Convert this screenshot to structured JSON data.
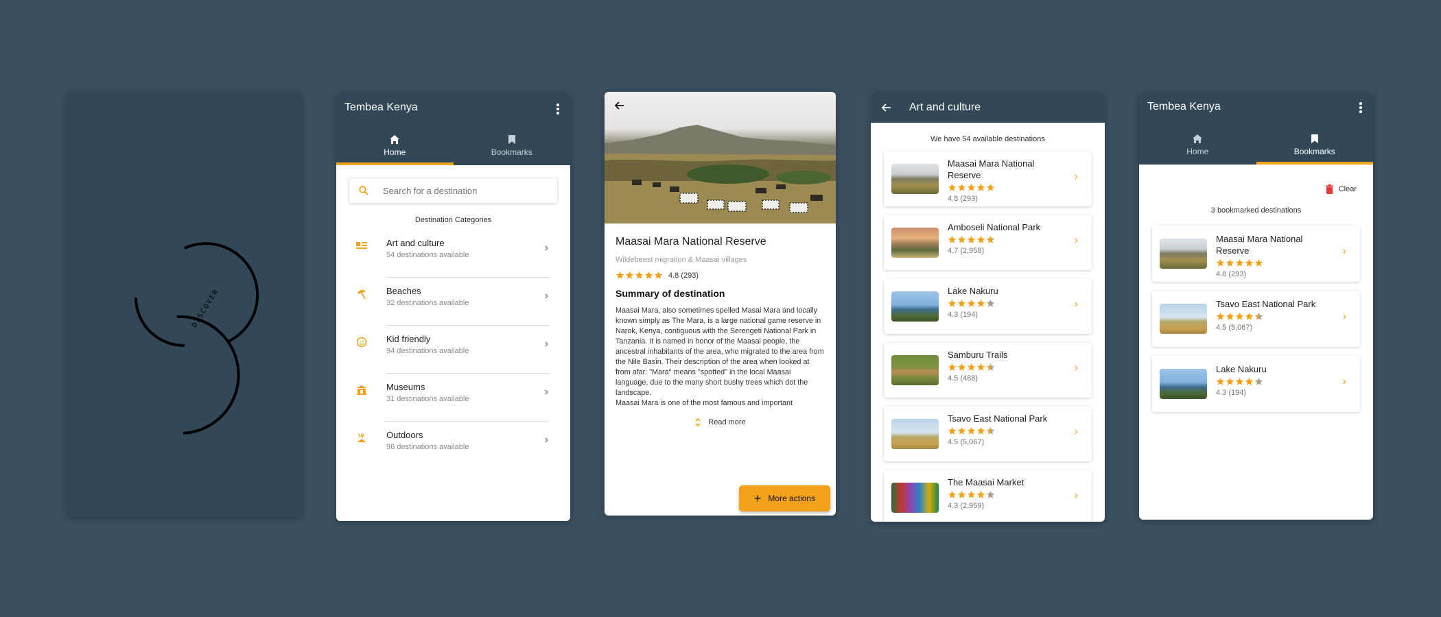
{
  "splash": {
    "label": "DISCOVER"
  },
  "home": {
    "title": "Tembea Kenya",
    "tabs": [
      {
        "label": "Home",
        "icon": "home-icon"
      },
      {
        "label": "Bookmarks",
        "icon": "bookmark-icon"
      }
    ],
    "search": {
      "placeholder": "Search for a destination"
    },
    "section_title": "Destination Categories",
    "categories": [
      {
        "name": "Art and culture",
        "sub": "54 destinations available",
        "icon": "art-culture-icon"
      },
      {
        "name": "Beaches",
        "sub": "32 destinations available",
        "icon": "beach-umbrella-icon"
      },
      {
        "name": "Kid friendly",
        "sub": "94 destinations available",
        "icon": "kid-face-icon"
      },
      {
        "name": "Museums",
        "sub": "31 destinations available",
        "icon": "museum-icon"
      },
      {
        "name": "Outdoors",
        "sub": "96 destinations available",
        "icon": "outdoors-icon"
      }
    ]
  },
  "detail": {
    "title": "Maasai Mara National Reserve",
    "subtitle": "Wildebeest migration & Maasai villages",
    "rating": 4.8,
    "rating_text": "4.8 (293)",
    "summary_title": "Summary of destination",
    "summary": "Maasai Mara, also sometimes spelled Masai Mara and locally known simply as The Mara, is a large national game reserve in Narok, Kenya, contiguous with the Serengeti National Park in Tanzania. It is named in honor of the Maasai people, the ancestral inhabitants of the area, who migrated to the area from the Nile Basin. Their description of the area when looked at from afar: \"Mara\" means \"spotted\" in the local Maasai language, due to the many short bushy trees which dot the landscape.\nMaasai Mara is one of the most famous and important",
    "read_more": "Read more",
    "fab": "More actions"
  },
  "category": {
    "title": "Art and culture",
    "count_text": "We have 54 available destinations",
    "items": [
      {
        "name": "Maasai Mara National Reserve",
        "rating": 4.8,
        "rating_text": "4.8 (293)",
        "thumb": "savanna"
      },
      {
        "name": "Amboseli National Park",
        "rating": 4.7,
        "rating_text": "4.7 (2,958)",
        "thumb": "sunset"
      },
      {
        "name": "Lake Nakuru",
        "rating": 4.3,
        "rating_text": "4.3 (194)",
        "thumb": "lake"
      },
      {
        "name": "Samburu Trails",
        "rating": 4.5,
        "rating_text": "4.5 (488)",
        "thumb": "trail"
      },
      {
        "name": "Tsavo East National Park",
        "rating": 4.5,
        "rating_text": "4.5 (5,067)",
        "thumb": "acacia"
      },
      {
        "name": "The Maasai Market",
        "rating": 4.3,
        "rating_text": "4.3 (2,959)",
        "thumb": "market"
      }
    ]
  },
  "bookmarks": {
    "title": "Tembea Kenya",
    "tabs": [
      {
        "label": "Home",
        "icon": "home-icon"
      },
      {
        "label": "Bookmarks",
        "icon": "bookmark-icon"
      }
    ],
    "clear_label": "Clear",
    "count_text": "3 bookmarked destinations",
    "items": [
      {
        "name": "Maasai Mara National Reserve",
        "rating": 4.8,
        "rating_text": "4.8 (293)",
        "thumb": "savanna"
      },
      {
        "name": "Tsavo East National Park",
        "rating": 4.5,
        "rating_text": "4.5 (5,067)",
        "thumb": "acacia"
      },
      {
        "name": "Lake Nakuru",
        "rating": 4.3,
        "rating_text": "4.3 (194)",
        "thumb": "lake"
      }
    ]
  },
  "colors": {
    "background": "#3b4f5f",
    "appbar": "#324857",
    "accent": "#f3a11b",
    "danger": "#e53935"
  }
}
